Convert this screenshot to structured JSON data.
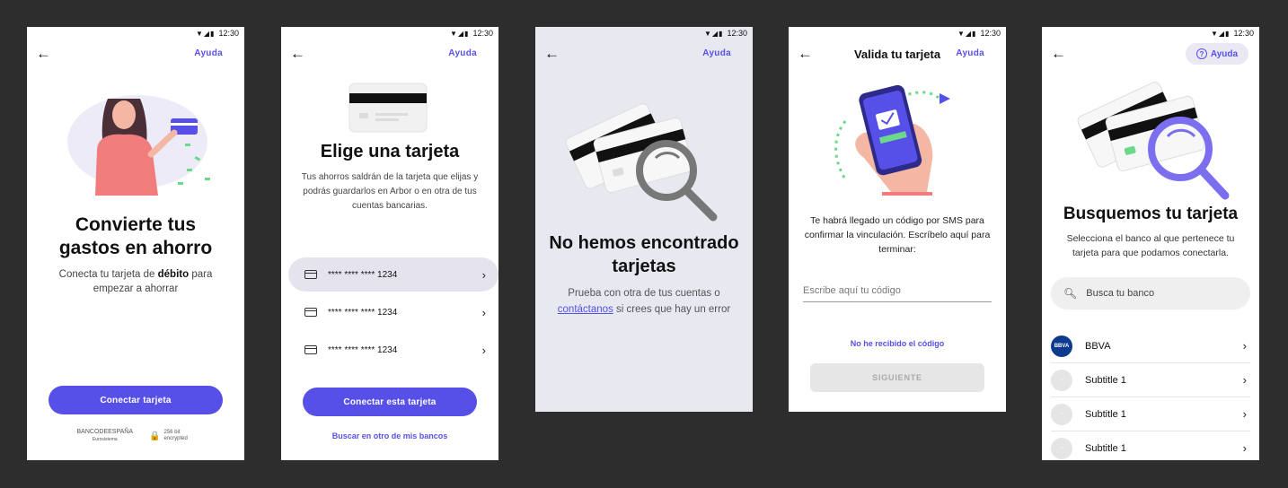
{
  "status_time": "12:30",
  "screens": [
    {
      "help": "Ayuda",
      "title": "Convierte tus gastos en ahorro",
      "body_pre": "Conecta tu tarjeta de ",
      "body_bold": "débito",
      "body_post": " para empezar a ahorrar",
      "button": "Conectar tarjeta",
      "footer_bank": "BANCODEESPAÑA",
      "footer_bank_sub": "Eurosistema",
      "footer_secure": "256 bit encrypted"
    },
    {
      "help": "Ayuda",
      "title": "Elige una tarjeta",
      "body": "Tus ahorros saldrán de la tarjeta que elijas y podrás guardarlos en Arbor o en otra de tus cuentas bancarias.",
      "cards": [
        "**** **** **** 1234",
        "**** **** **** 1234",
        "**** **** **** 1234"
      ],
      "button": "Conectar esta tarjeta",
      "link": "Buscar en otro de mis bancos"
    },
    {
      "help": "Ayuda",
      "title": "No hemos encontrado tarjetas",
      "body_pre": "Prueba con otra de tus cuentas o ",
      "body_link": "contáctanos",
      "body_post": " si crees que hay un error"
    },
    {
      "header_title": "Valida tu tarjeta",
      "help": "Ayuda",
      "body": "Te habrá llegado un código por SMS para confirmar la vinculación. Escríbelo aquí para terminar:",
      "input_placeholder": "Escribe aquí tu código",
      "link": "No he recibido el código",
      "button": "SIGUIENTE"
    },
    {
      "help": "Ayuda",
      "title": "Busquemos tu tarjeta",
      "body": "Selecciona el banco al que pertenece tu tarjeta para que podamos conectarla.",
      "search_placeholder": "Busca tu banco",
      "banks": [
        {
          "logo": "BBVA",
          "name": "BBVA"
        },
        {
          "logo": "",
          "name": "Subtitle 1"
        },
        {
          "logo": "",
          "name": "Subtitle 1"
        },
        {
          "logo": "",
          "name": "Subtitle 1"
        }
      ]
    }
  ],
  "colors": {
    "accent": "#5650e9",
    "background": "#2d2d2d",
    "illustration_pink": "#f07c7c",
    "illustration_green": "#6bd88a"
  }
}
